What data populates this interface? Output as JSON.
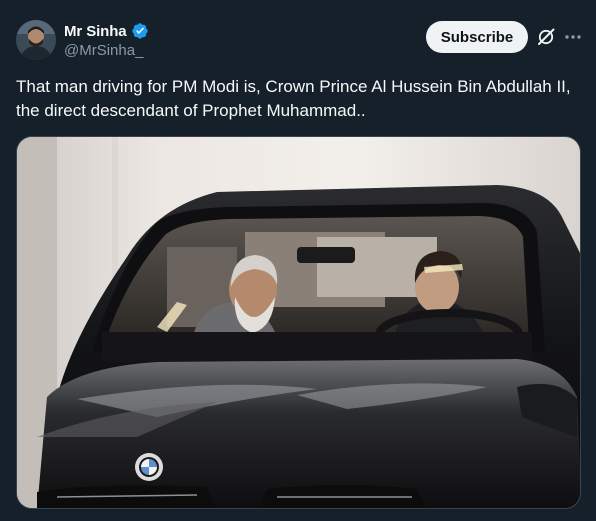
{
  "author": {
    "display_name": "Mr Sinha",
    "handle": "@MrSinha_",
    "verified": true,
    "verified_color": "#1d9bf0",
    "avatar_icon": "profile-avatar"
  },
  "actions": {
    "subscribe_label": "Subscribe",
    "grok_icon": "grok-icon",
    "more_icon": "more-dots-icon"
  },
  "tweet": {
    "text": "That man driving for PM Modi is, Crown Prince Al Hussein Bin Abdullah II, the direct descendant of Prophet Muhammad.."
  },
  "media": {
    "type": "photo",
    "subject": "car-photo"
  },
  "theme": {
    "background": "#15202b",
    "text_primary": "#f7f9f9",
    "text_secondary": "#8b98a5",
    "button_bg": "#eff3f4"
  }
}
